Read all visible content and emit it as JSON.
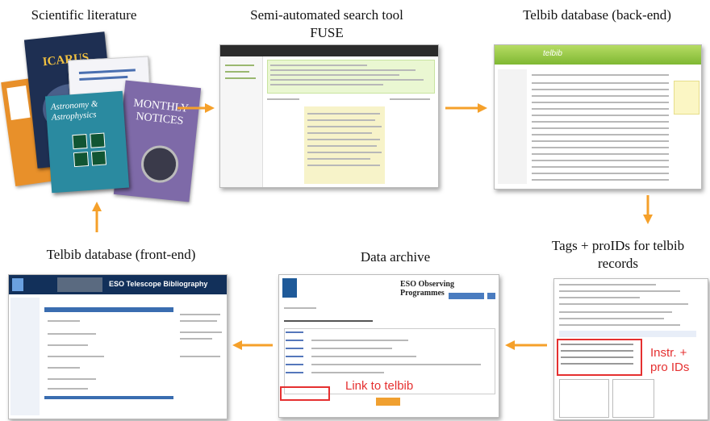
{
  "stages": {
    "literature": {
      "label": "Scientific literature",
      "journal_1": "ICARUS",
      "journal_2": "MONTHLY NOTICES",
      "journal_3": "Astronomy & Astrophysics"
    },
    "fuse": {
      "label_line1": "Semi-automated search tool",
      "label_line2": "FUSE"
    },
    "backend": {
      "label": "Telbib database (back-end)",
      "app_name": "telbib"
    },
    "tags": {
      "label_line1": "Tags + proIDs for telbib",
      "label_line2": "records",
      "annotation_line1": "Instr. +",
      "annotation_line2": "pro IDs"
    },
    "archive": {
      "label": "Data archive",
      "header_title": "ESO Observing Programmes",
      "annotation": "Link to telbib"
    },
    "frontend": {
      "label": "Telbib database (front-end)",
      "header_title": "ESO Telescope Bibliography"
    }
  },
  "colors": {
    "arrow": "#f5a02a",
    "annotation": "#e53030",
    "fuse_green": "#eaf7d2",
    "telbib_green": "#8fc83a",
    "eso_blue": "#1f5a99"
  }
}
